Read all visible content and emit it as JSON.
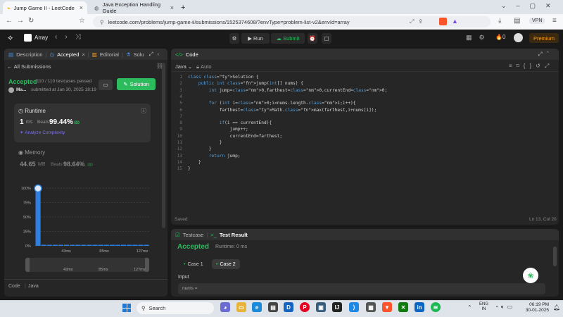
{
  "browser": {
    "tabs": [
      {
        "title": "Jump Game II - LeetCode",
        "active": true
      },
      {
        "title": "Java Exception Handling Guide",
        "active": false
      }
    ],
    "new_tab": "+",
    "url": "leetcode.com/problems/jump-game-ii/submissions/1525374608/?envType=problem-list-v2&envId=array",
    "vpn": "VPN"
  },
  "topbar": {
    "list": "Array",
    "run": "Run",
    "submit": "Submit",
    "coins": "0",
    "premium": "Premium"
  },
  "left": {
    "tabs": [
      "Description",
      "Accepted",
      "Editorial",
      "Solu"
    ],
    "all_submissions": "All Submissions",
    "status": "Accepted",
    "testcases": "110 / 110 testcases passed",
    "user": "Ma...",
    "submitted": "submitted at Jan 30, 2025 18:19",
    "solution_btn": "Solution",
    "runtime_label": "Runtime",
    "runtime_value": "1",
    "runtime_unit": "ms",
    "beats_label": "Beats",
    "runtime_beats": "99.44%",
    "analyze": "Analyze Complexity",
    "memory_label": "Memory",
    "memory_value": "44.65",
    "memory_unit": "MB",
    "memory_beats": "98.64%",
    "code_label": "Code",
    "code_lang": "Java"
  },
  "chart_data": {
    "type": "bar",
    "yticks": [
      "100%",
      "75%",
      "50%",
      "25%",
      "0%"
    ],
    "xticks": [
      "43ms",
      "85ms",
      "127ms"
    ],
    "mini_xticks": [
      "43ms",
      "85ms",
      "127ms"
    ],
    "ylim": [
      0,
      100
    ],
    "highlight": {
      "x": 1,
      "y": 99.44
    },
    "bars": [
      99.4,
      0.3,
      0.2,
      0.2,
      0.2,
      0.2,
      0.1,
      0.1,
      0.1,
      0.1,
      0.1,
      0.1,
      0.1,
      0.1,
      0.1,
      0.1,
      0.1,
      0.1,
      0.1,
      0.1
    ]
  },
  "code": {
    "title": "Code",
    "lang": "Java",
    "auto": "Auto",
    "lines": [
      "class Solution {",
      "    public int jump(int[] nums) {",
      "        int jump=0,farthest=0,currentEnd=0;",
      "",
      "        for (int i=0;i<nums.length-1;i++){",
      "            farthest=Math.max(farthest,i+nums[i]);",
      "",
      "            if(i == currentEnd){",
      "                jump++;",
      "                currentEnd=farthest;",
      "            }",
      "        }",
      "        return jump;",
      "    }",
      "}"
    ],
    "saved": "Saved",
    "cursor": "Ln 13, Col 20"
  },
  "result": {
    "testcase_tab": "Testcase",
    "result_tab": "Test Result",
    "status": "Accepted",
    "runtime": "Runtime: 0 ms",
    "cases": [
      "Case 1",
      "Case 2"
    ],
    "input_label": "Input",
    "input_value": "nums ="
  },
  "taskbar": {
    "search": "Search",
    "lang1": "ENG",
    "lang2": "IN",
    "time": "06:19 PM",
    "date": "30-01-2025"
  },
  "colors": {
    "accent_green": "#2cbb5d",
    "premium": "#ffa116",
    "bg": "#1a1a1a",
    "panel": "#262626"
  }
}
